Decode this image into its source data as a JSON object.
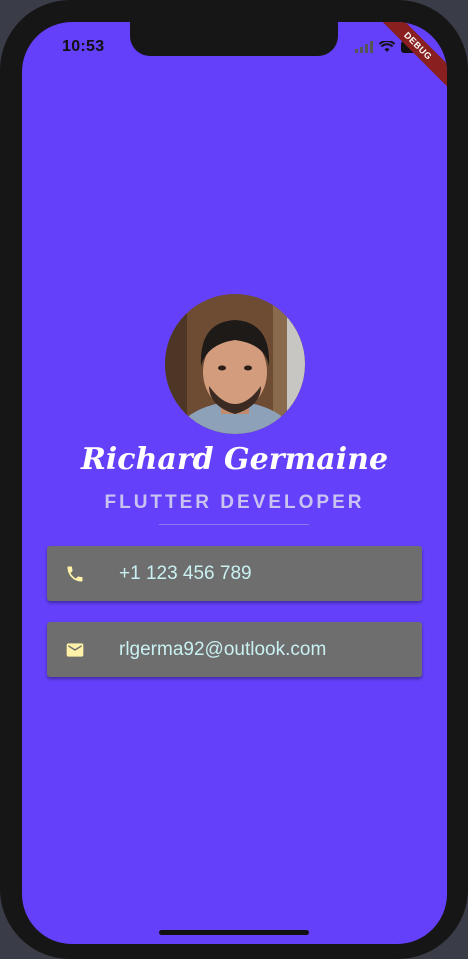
{
  "status_bar": {
    "time": "10:53",
    "debug_label": "DEBUG"
  },
  "profile": {
    "name": "Richard Germaine",
    "title": "FLUTTER DEVELOPER",
    "avatar": "avatar-photo"
  },
  "contacts": [
    {
      "icon": "phone-icon",
      "value": "+1 123 456 789"
    },
    {
      "icon": "email-icon",
      "value": "rlgerma92@outlook.com"
    }
  ],
  "colors": {
    "background": "#6540fb",
    "card": "#6e6e6e",
    "card_text": "#c9f1f2",
    "icon": "#fff2a8",
    "role_text": "#c9c3f2"
  }
}
